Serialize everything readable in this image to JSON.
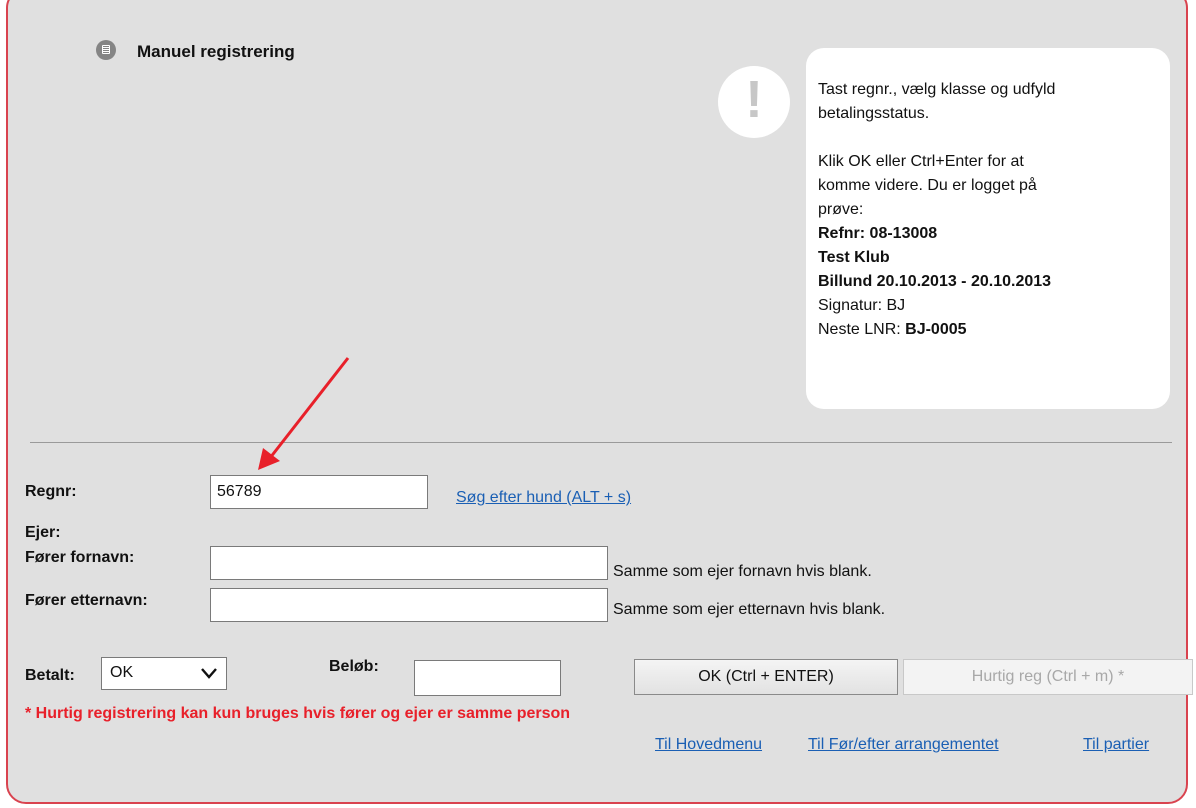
{
  "title": "Manuel registrering",
  "info_bubble": {
    "line1": "Tast regnr., vælg klasse og udfyld",
    "line2": "betalingsstatus.",
    "line3": "Klik OK eller Ctrl+Enter for at",
    "line4": "komme videre. Du er logget på",
    "line5": "prøve:",
    "refnr": "Refnr: 08-13008",
    "club": "Test Klub",
    "event": "Billund 20.10.2013 - 20.10.2013",
    "signatur": "Signatur: BJ",
    "next_lnr_label": "Neste LNR: ",
    "next_lnr_value": "BJ-0005"
  },
  "form": {
    "regnr_label": "Regnr:",
    "regnr_value": "56789",
    "search_link": "Søg efter hund (ALT + s)",
    "owner_label": "Ejer:",
    "handler_first_label": "Fører fornavn:",
    "handler_first_value": "",
    "handler_first_hint": "Samme som ejer fornavn hvis blank.",
    "handler_last_label": "Fører etternavn:",
    "handler_last_value": "",
    "handler_last_hint": "Samme som ejer etternavn hvis blank.",
    "paid_label": "Betalt:",
    "paid_selected": "OK",
    "amount_label": "Beløb:",
    "amount_value": ""
  },
  "buttons": {
    "ok": "OK (Ctrl + ENTER)",
    "quick_reg": "Hurtig reg (Ctrl + m) *"
  },
  "note": "* Hurtig registrering kan kun bruges hvis fører og ejer er samme person",
  "links": {
    "main_menu": "Til Hovedmenu",
    "before_after": "Til Før/efter arrangementet",
    "parties": "Til partier"
  },
  "colors": {
    "panel_bg": "#e0e0e0",
    "panel_border": "#d9434f",
    "link": "#1a5fb4",
    "note": "#e8202a",
    "arrow": "#e8202a"
  }
}
